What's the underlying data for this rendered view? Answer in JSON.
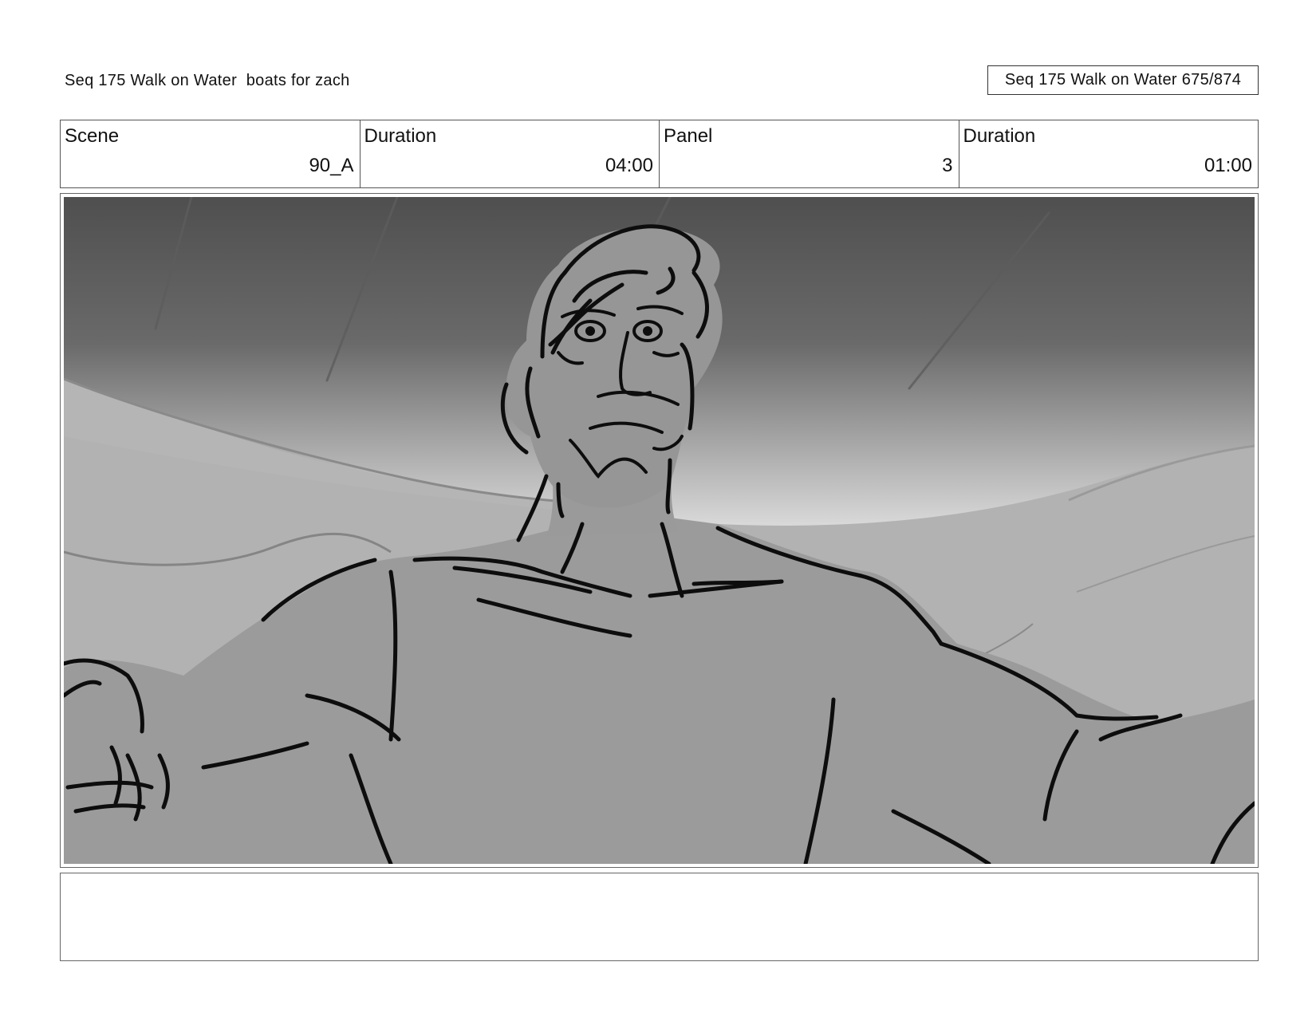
{
  "header": {
    "left_title": "Seq 175 Walk on Water  boats for zach",
    "right_title": "Seq 175 Walk on Water 675/874"
  },
  "info": {
    "scene_label": "Scene",
    "scene_value": "90_A",
    "scene_duration_label": "Duration",
    "scene_duration_value": "04:00",
    "panel_label": "Panel",
    "panel_value": "3",
    "panel_duration_label": "Duration",
    "panel_duration_value": "01:00"
  },
  "notes": {
    "text": ""
  },
  "colors": {
    "sky_top": "#4f4f4f",
    "sky_bottom": "#e6e6e6",
    "waves": "#b2b2b2",
    "figure": "#9a9a9a",
    "ink": "#0d0d0d"
  }
}
